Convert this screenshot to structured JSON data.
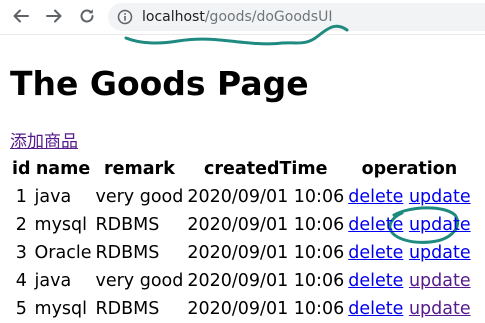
{
  "browser": {
    "address_host": "localhost",
    "address_path": "/goods/doGoodsUI"
  },
  "page": {
    "title": "The Goods Page",
    "add_link": "添加商品"
  },
  "table": {
    "headers": [
      "id",
      "name",
      "remark",
      "createdTime",
      "operation"
    ],
    "delete_label": "delete",
    "update_label": "update",
    "rows": [
      {
        "id": "1",
        "name": "java",
        "remark": "very good",
        "createdTime": "2020/09/01 10:06"
      },
      {
        "id": "2",
        "name": "mysql",
        "remark": "RDBMS",
        "createdTime": "2020/09/01 10:06"
      },
      {
        "id": "3",
        "name": "Oracle",
        "remark": "RDBMS",
        "createdTime": "2020/09/01 10:06"
      },
      {
        "id": "4",
        "name": "java",
        "remark": "very good",
        "createdTime": "2020/09/01 10:06"
      },
      {
        "id": "5",
        "name": "mysql",
        "remark": "RDBMS",
        "createdTime": "2020/09/01 10:06"
      }
    ]
  },
  "colors": {
    "link": "#0000ee",
    "visited_link": "#551a8b",
    "annotation": "#1f8a80"
  }
}
